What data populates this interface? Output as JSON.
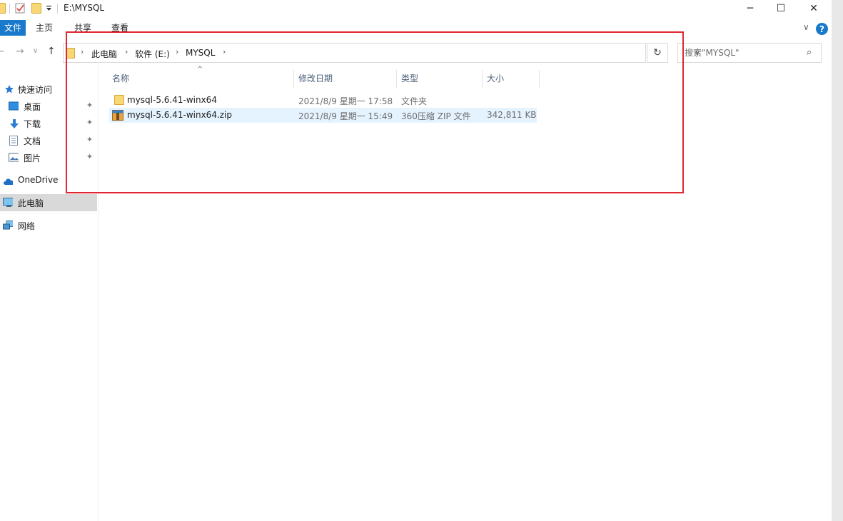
{
  "window": {
    "title": "E:\\MYSQL",
    "minimize_glyph": "─",
    "maximize_glyph": "☐",
    "close_glyph": "✕"
  },
  "ribbon": {
    "tabs": [
      "文件",
      "主页",
      "共享",
      "查看"
    ],
    "expand_glyph": "∨",
    "help_glyph": "?"
  },
  "nav_buttons": {
    "back": "←",
    "forward": "→",
    "recent": "∨",
    "up": "↑"
  },
  "address": {
    "breadcrumbs": [
      "此电脑",
      "软件 (E:)",
      "MYSQL"
    ],
    "separator": "›",
    "dropdown_glyph": "∨",
    "refresh_glyph": "↻"
  },
  "search": {
    "placeholder": "搜索\"MYSQL\"",
    "icon_glyph": "⌕"
  },
  "navpane": {
    "quick_access": "快速访问",
    "pinned": [
      "桌面",
      "下载",
      "文档",
      "图片"
    ],
    "onedrive": "OneDrive",
    "this_pc": "此电脑",
    "network": "网络",
    "pin_glyph": "📌"
  },
  "columns": {
    "name": "名称",
    "modified": "修改日期",
    "type": "类型",
    "size": "大小",
    "sort_glyph": "^"
  },
  "files": [
    {
      "name": "mysql-5.6.41-winx64",
      "modified": "2021/8/9 星期一 17:58",
      "type": "文件夹",
      "size": ""
    },
    {
      "name": "mysql-5.6.41-winx64.zip",
      "modified": "2021/8/9 星期一 15:49",
      "type": "360压缩 ZIP 文件",
      "size": "342,811 KB"
    }
  ],
  "colors": {
    "accent": "#1979ca",
    "selection": "#e5f3ff",
    "annotation": "#e0262e",
    "folder": "#f8d775"
  }
}
